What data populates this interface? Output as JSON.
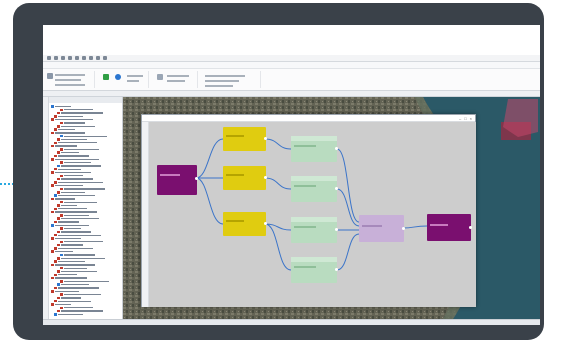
{
  "window": {
    "title": ""
  },
  "ribbon": {
    "tabs": [
      "",
      "",
      "",
      "",
      "",
      "",
      "",
      "",
      "",
      "",
      "",
      ""
    ]
  },
  "status": {
    "left": "",
    "mid": ""
  },
  "dialog": {
    "title": ""
  },
  "colors": {
    "device": "#3a4149",
    "accent_dots": "#29a9e0",
    "node_source": "#7a0f6f",
    "node_filter": "#e0cc10",
    "node_transform": "#b9dcc0",
    "node_merge": "#c8b0d8",
    "node_output": "#7a0f6f",
    "link": "#3b74c9",
    "canvas": "#cdcdcd"
  },
  "nodes": [
    {
      "id": "source",
      "kind": "source",
      "label": ""
    },
    {
      "id": "filter-1",
      "kind": "filter",
      "label": ""
    },
    {
      "id": "filter-2",
      "kind": "filter",
      "label": ""
    },
    {
      "id": "filter-3",
      "kind": "filter",
      "label": ""
    },
    {
      "id": "transform-1",
      "kind": "transform",
      "label": ""
    },
    {
      "id": "transform-2",
      "kind": "transform",
      "label": ""
    },
    {
      "id": "transform-3",
      "kind": "transform",
      "label": ""
    },
    {
      "id": "transform-4",
      "kind": "transform",
      "label": ""
    },
    {
      "id": "merge",
      "kind": "merge",
      "label": ""
    },
    {
      "id": "output",
      "kind": "output",
      "label": ""
    }
  ]
}
